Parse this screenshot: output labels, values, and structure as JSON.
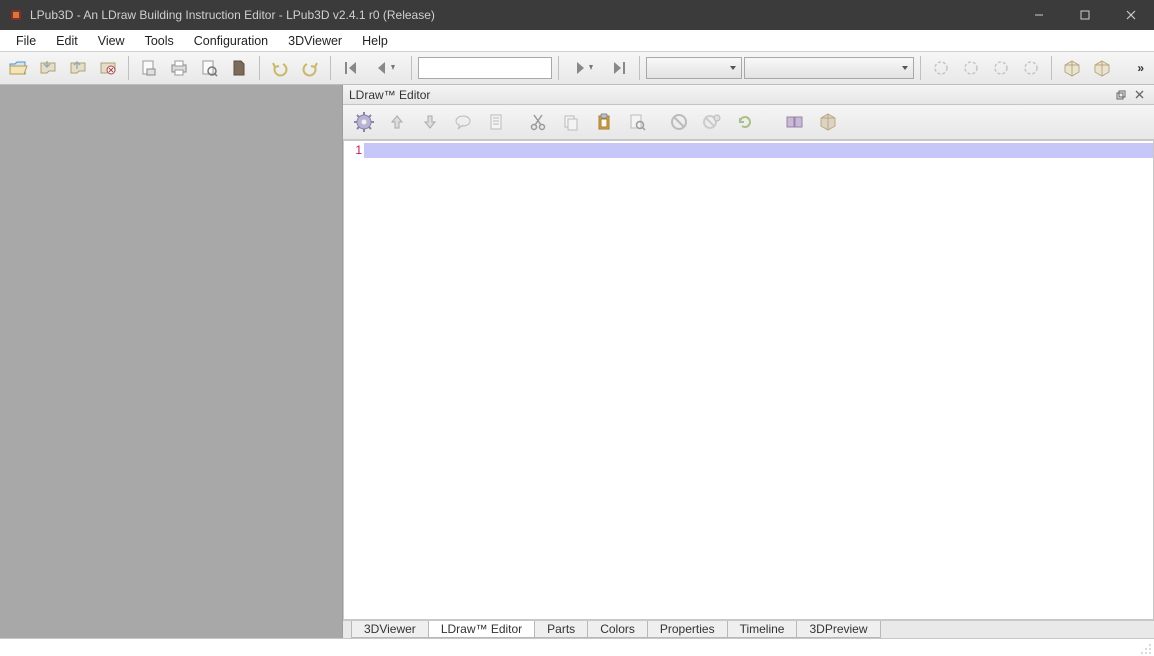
{
  "title": "LPub3D - An LDraw Building Instruction Editor - LPub3D v2.4.1 r0 (Release)",
  "menus": [
    "File",
    "Edit",
    "View",
    "Tools",
    "Configuration",
    "3DViewer",
    "Help"
  ],
  "toolbar_icons": [
    "open-folder",
    "save-arrow",
    "folder-up",
    "folder-cancel",
    "export-doc",
    "print",
    "print-preview",
    "page-dark"
  ],
  "nav_icons": [
    "undo",
    "redo"
  ],
  "page_nav_icons": [
    "first-page",
    "prev-page"
  ],
  "page_input": "",
  "page_nav_icons2": [
    "next-page",
    "last-page"
  ],
  "combo1": "",
  "combo2": "",
  "extra_icons": [
    "rotate-a",
    "rotate-b",
    "rotate-c",
    "rotate-d",
    "cube-a",
    "cube-b"
  ],
  "overflow": "»",
  "dock": {
    "title": "LDraw™ Editor",
    "float_icon": "⧉",
    "close_icon": "✕"
  },
  "editor_toolbar_icons": [
    "gear",
    "arrow-up",
    "arrow-down",
    "comment",
    "page-lines",
    "cut",
    "copy",
    "paste",
    "find",
    "no-entry",
    "no-entry2",
    "reload",
    "",
    "block-a",
    "block-b"
  ],
  "line_number": "1",
  "tabs": [
    "3DViewer",
    "LDraw™ Editor",
    "Parts",
    "Colors",
    "Properties",
    "Timeline",
    "3DPreview"
  ],
  "active_tab": 1
}
